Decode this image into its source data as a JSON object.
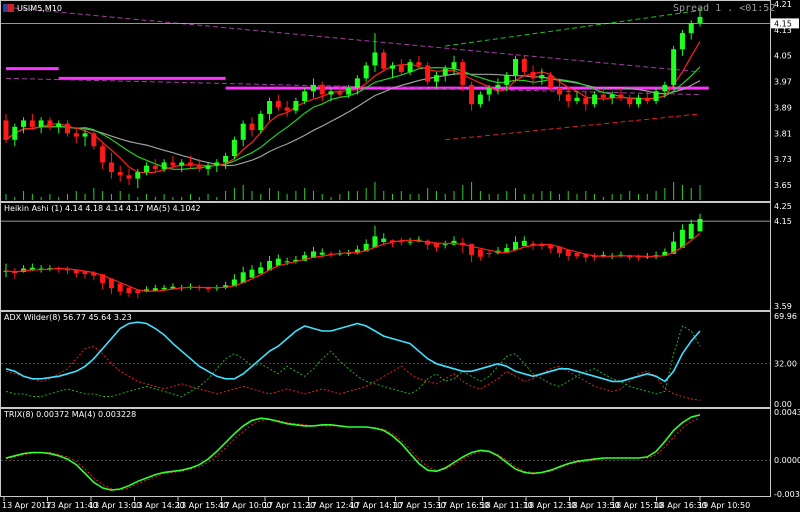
{
  "window": {
    "title": "USIM5,M10",
    "spread_text": "Spread 1 . <01:52"
  },
  "colors": {
    "background": "#000000",
    "bull": "#1fff1f",
    "bear": "#ff1a1a",
    "border": "#c8c8c8",
    "ma_fast": "#ff2020",
    "ma_mid": "#20d020",
    "ma_slow": "#a0a0a0",
    "magenta": "#ff33ff",
    "adx": "#40e0ff",
    "plus_di": "#20c020",
    "minus_di": "#ff2020",
    "trix": "#30ff30",
    "trix_signal": "#ff2020"
  },
  "chart_data": [
    {
      "type": "candlestick",
      "panel": "main",
      "title": "USIM5,M10",
      "ylim": [
        3.61,
        4.21
      ],
      "y_ticks": [
        "4.21",
        "4.13",
        "4.05",
        "3.97",
        "3.89",
        "3.81",
        "3.73",
        "3.65"
      ],
      "current_price": "4.15",
      "ohlc": [
        [
          3.85,
          3.87,
          3.78,
          3.79
        ],
        [
          3.79,
          3.84,
          3.77,
          3.83
        ],
        [
          3.83,
          3.86,
          3.81,
          3.85
        ],
        [
          3.85,
          3.87,
          3.82,
          3.83
        ],
        [
          3.83,
          3.86,
          3.81,
          3.85
        ],
        [
          3.85,
          3.86,
          3.82,
          3.83
        ],
        [
          3.83,
          3.85,
          3.81,
          3.84
        ],
        [
          3.84,
          3.85,
          3.8,
          3.81
        ],
        [
          3.81,
          3.83,
          3.78,
          3.8
        ],
        [
          3.8,
          3.82,
          3.77,
          3.81
        ],
        [
          3.81,
          3.82,
          3.76,
          3.77
        ],
        [
          3.77,
          3.78,
          3.7,
          3.72
        ],
        [
          3.72,
          3.75,
          3.67,
          3.69
        ],
        [
          3.69,
          3.71,
          3.66,
          3.68
        ],
        [
          3.68,
          3.7,
          3.65,
          3.67
        ],
        [
          3.67,
          3.7,
          3.64,
          3.69
        ],
        [
          3.69,
          3.72,
          3.68,
          3.71
        ],
        [
          3.71,
          3.73,
          3.69,
          3.7
        ],
        [
          3.7,
          3.73,
          3.69,
          3.72
        ],
        [
          3.72,
          3.74,
          3.7,
          3.71
        ],
        [
          3.71,
          3.73,
          3.69,
          3.72
        ],
        [
          3.72,
          3.74,
          3.7,
          3.71
        ],
        [
          3.71,
          3.73,
          3.69,
          3.7
        ],
        [
          3.7,
          3.72,
          3.68,
          3.71
        ],
        [
          3.71,
          3.73,
          3.69,
          3.72
        ],
        [
          3.72,
          3.75,
          3.7,
          3.74
        ],
        [
          3.74,
          3.8,
          3.73,
          3.79
        ],
        [
          3.79,
          3.85,
          3.77,
          3.84
        ],
        [
          3.84,
          3.86,
          3.8,
          3.82
        ],
        [
          3.82,
          3.88,
          3.81,
          3.87
        ],
        [
          3.87,
          3.92,
          3.85,
          3.91
        ],
        [
          3.91,
          3.93,
          3.88,
          3.89
        ],
        [
          3.89,
          3.91,
          3.86,
          3.88
        ],
        [
          3.88,
          3.92,
          3.87,
          3.91
        ],
        [
          3.91,
          3.95,
          3.9,
          3.94
        ],
        [
          3.94,
          3.98,
          3.92,
          3.96
        ],
        [
          3.96,
          3.97,
          3.91,
          3.93
        ],
        [
          3.93,
          3.95,
          3.91,
          3.94
        ],
        [
          3.94,
          3.96,
          3.92,
          3.93
        ],
        [
          3.93,
          3.96,
          3.92,
          3.95
        ],
        [
          3.95,
          3.99,
          3.93,
          3.98
        ],
        [
          3.98,
          4.03,
          3.97,
          4.02
        ],
        [
          4.02,
          4.12,
          4.0,
          4.06
        ],
        [
          4.06,
          4.07,
          4.0,
          4.01
        ],
        [
          4.01,
          4.03,
          3.98,
          4.02
        ],
        [
          4.02,
          4.04,
          3.99,
          4.0
        ],
        [
          4.0,
          4.04,
          3.99,
          4.03
        ],
        [
          4.03,
          4.05,
          4.01,
          4.02
        ],
        [
          4.02,
          4.03,
          3.96,
          3.97
        ],
        [
          3.97,
          4.0,
          3.95,
          3.99
        ],
        [
          3.99,
          4.02,
          3.97,
          4.01
        ],
        [
          4.01,
          4.05,
          3.99,
          4.03
        ],
        [
          4.03,
          4.04,
          3.94,
          3.96
        ],
        [
          3.96,
          3.97,
          3.88,
          3.9
        ],
        [
          3.9,
          3.94,
          3.89,
          3.93
        ],
        [
          3.93,
          3.96,
          3.91,
          3.95
        ],
        [
          3.95,
          3.98,
          3.93,
          3.96
        ],
        [
          3.96,
          4.0,
          3.94,
          3.99
        ],
        [
          3.99,
          4.05,
          3.97,
          4.04
        ],
        [
          4.04,
          4.05,
          3.99,
          4.0
        ],
        [
          4.0,
          4.02,
          3.96,
          3.98
        ],
        [
          3.98,
          4.01,
          3.96,
          3.99
        ],
        [
          3.99,
          4.0,
          3.94,
          3.95
        ],
        [
          3.95,
          3.97,
          3.91,
          3.93
        ],
        [
          3.93,
          3.95,
          3.89,
          3.91
        ],
        [
          3.91,
          3.94,
          3.9,
          3.92
        ],
        [
          3.92,
          3.94,
          3.88,
          3.9
        ],
        [
          3.9,
          3.94,
          3.89,
          3.93
        ],
        [
          3.93,
          3.95,
          3.91,
          3.92
        ],
        [
          3.92,
          3.94,
          3.9,
          3.93
        ],
        [
          3.93,
          3.95,
          3.91,
          3.92
        ],
        [
          3.92,
          3.93,
          3.89,
          3.9
        ],
        [
          3.9,
          3.93,
          3.89,
          3.92
        ],
        [
          3.92,
          3.94,
          3.9,
          3.91
        ],
        [
          3.91,
          3.95,
          3.9,
          3.94
        ],
        [
          3.94,
          3.97,
          3.92,
          3.96
        ],
        [
          3.96,
          4.08,
          3.95,
          4.07
        ],
        [
          4.07,
          4.13,
          4.05,
          4.12
        ],
        [
          4.12,
          4.16,
          4.1,
          4.15
        ],
        [
          4.15,
          4.2,
          4.14,
          4.17
        ]
      ],
      "magenta_steps": [
        {
          "from": 0,
          "to": 6,
          "value": 4.01
        },
        {
          "from": 6,
          "to": 25,
          "value": 3.98
        },
        {
          "from": 25,
          "to": 80,
          "value": 3.95
        }
      ],
      "trend_lines": [
        {
          "color": "green",
          "from": [
            50,
            4.08
          ],
          "to": [
            79,
            4.19
          ]
        },
        {
          "color": "red",
          "from": [
            50,
            3.79
          ],
          "to": [
            79,
            3.87
          ]
        },
        {
          "color": "purple",
          "from": [
            0,
            4.2
          ],
          "to": [
            79,
            4.0
          ]
        },
        {
          "color": "purple",
          "from": [
            0,
            3.98
          ],
          "to": [
            79,
            3.93
          ]
        }
      ],
      "volume": [
        2,
        1,
        3,
        2,
        1,
        2,
        1,
        2,
        3,
        2,
        4,
        3,
        2,
        3,
        2,
        1,
        2,
        1,
        2,
        1,
        1,
        2,
        1,
        2,
        1,
        3,
        4,
        5,
        3,
        2,
        4,
        3,
        2,
        3,
        4,
        3,
        2,
        1,
        2,
        3,
        3,
        4,
        6,
        3,
        2,
        3,
        2,
        2,
        4,
        3,
        2,
        3,
        5,
        6,
        3,
        2,
        2,
        3,
        4,
        2,
        2,
        3,
        3,
        2,
        3,
        2,
        3,
        2,
        1,
        2,
        2,
        3,
        2,
        2,
        3,
        4,
        6,
        5,
        4,
        5
      ]
    },
    {
      "type": "candlestick",
      "panel": "heikin_ashi",
      "title": "Heikin Ashi (1) 4.14 4.18 4.14 4.17 MA(5) 4.1042",
      "ylim": [
        3.59,
        4.25
      ],
      "y_ticks": [
        "4.25",
        "4.15",
        "3.59"
      ],
      "current_price": "4.15"
    },
    {
      "type": "line",
      "panel": "adx",
      "title": "ADX Wilder(8) 56.77 45.64 3.23",
      "ylim": [
        0,
        69.96
      ],
      "y_ticks": [
        "69.96",
        "32.00",
        "0.00"
      ],
      "reference_line": 32,
      "series": [
        {
          "name": "ADX",
          "values": [
            28,
            26,
            22,
            20,
            20,
            21,
            22,
            24,
            26,
            30,
            36,
            44,
            52,
            60,
            64,
            65,
            64,
            60,
            55,
            48,
            42,
            36,
            30,
            26,
            22,
            20,
            20,
            24,
            30,
            36,
            42,
            46,
            52,
            58,
            62,
            60,
            58,
            58,
            60,
            62,
            64,
            62,
            58,
            54,
            52,
            50,
            48,
            42,
            36,
            32,
            30,
            28,
            26,
            26,
            28,
            30,
            32,
            30,
            26,
            24,
            22,
            24,
            26,
            28,
            28,
            26,
            24,
            22,
            20,
            18,
            18,
            20,
            22,
            24,
            22,
            18,
            26,
            40,
            50,
            58
          ]
        },
        {
          "name": "+DI",
          "values": [
            10,
            8,
            8,
            6,
            6,
            8,
            10,
            12,
            10,
            8,
            8,
            6,
            6,
            8,
            10,
            12,
            14,
            12,
            10,
            8,
            6,
            10,
            14,
            20,
            28,
            36,
            40,
            36,
            30,
            32,
            28,
            24,
            30,
            26,
            22,
            28,
            36,
            42,
            34,
            28,
            22,
            18,
            16,
            14,
            12,
            10,
            8,
            12,
            20,
            24,
            18,
            20,
            26,
            22,
            18,
            22,
            30,
            38,
            40,
            32,
            24,
            20,
            16,
            14,
            18,
            22,
            26,
            28,
            24,
            20,
            18,
            14,
            12,
            10,
            8,
            10,
            40,
            62,
            58,
            46
          ]
        },
        {
          "name": "-DI",
          "values": [
            26,
            24,
            22,
            20,
            18,
            20,
            24,
            28,
            36,
            44,
            46,
            40,
            32,
            26,
            22,
            18,
            16,
            14,
            12,
            14,
            16,
            14,
            12,
            10,
            8,
            10,
            12,
            14,
            12,
            10,
            8,
            10,
            12,
            10,
            8,
            10,
            12,
            10,
            8,
            10,
            12,
            14,
            18,
            22,
            26,
            30,
            24,
            20,
            18,
            16,
            20,
            24,
            18,
            14,
            12,
            16,
            20,
            26,
            22,
            18,
            20,
            24,
            28,
            30,
            26,
            22,
            18,
            14,
            12,
            10,
            12,
            18,
            24,
            26,
            22,
            12,
            8,
            6,
            4,
            3
          ]
        }
      ]
    },
    {
      "type": "line",
      "panel": "trix",
      "title": "TRIX(8) 0.00372 MA(4) 0.003228",
      "ylim": [
        -0.00305,
        0.00436
      ],
      "y_ticks": [
        "0.00436",
        "0.0000",
        "-0.00305"
      ],
      "reference_line": 0,
      "series": [
        {
          "name": "TRIX(8)",
          "values": [
            0.0002,
            0.0004,
            0.0006,
            0.0007,
            0.0007,
            0.0006,
            0.0004,
            0.0001,
            -0.0004,
            -0.0012,
            -0.002,
            -0.0025,
            -0.0027,
            -0.0026,
            -0.0023,
            -0.0019,
            -0.0016,
            -0.0013,
            -0.0011,
            -0.001,
            -0.0009,
            -0.0007,
            -0.0004,
            0.0001,
            0.0008,
            0.0016,
            0.0024,
            0.0031,
            0.0036,
            0.0038,
            0.0037,
            0.0035,
            0.0033,
            0.0032,
            0.0031,
            0.0031,
            0.0032,
            0.0032,
            0.0031,
            0.003,
            0.003,
            0.003,
            0.0029,
            0.0027,
            0.0022,
            0.0015,
            0.0006,
            -0.0003,
            -0.0009,
            -0.001,
            -0.0007,
            -0.0002,
            0.0003,
            0.0007,
            0.0009,
            0.0008,
            0.0004,
            -0.0002,
            -0.0008,
            -0.0011,
            -0.0012,
            -0.0011,
            -0.0009,
            -0.0006,
            -0.0003,
            -0.0001,
            0.0,
            0.0001,
            0.0002,
            0.0002,
            0.0002,
            0.0002,
            0.0002,
            0.0003,
            0.0008,
            0.0017,
            0.0027,
            0.0034,
            0.0039,
            0.0041
          ]
        },
        {
          "name": "MA(4)",
          "values": [
            0.0001,
            0.0003,
            0.0005,
            0.0006,
            0.0007,
            0.0007,
            0.0005,
            0.0003,
            -0.0001,
            -0.0008,
            -0.0016,
            -0.0022,
            -0.0026,
            -0.0027,
            -0.0025,
            -0.0021,
            -0.0018,
            -0.0015,
            -0.0012,
            -0.0011,
            -0.001,
            -0.0008,
            -0.0006,
            -0.0002,
            0.0004,
            0.0011,
            0.0019,
            0.0026,
            0.0032,
            0.0036,
            0.0037,
            0.0036,
            0.0034,
            0.0033,
            0.0032,
            0.0031,
            0.0031,
            0.0031,
            0.0031,
            0.003,
            0.003,
            0.003,
            0.0029,
            0.0028,
            0.0024,
            0.0018,
            0.001,
            0.0001,
            -0.0006,
            -0.0009,
            -0.0008,
            -0.0004,
            0.0001,
            0.0005,
            0.0008,
            0.0008,
            0.0005,
            0.0,
            -0.0006,
            -0.001,
            -0.0011,
            -0.0011,
            -0.001,
            -0.0007,
            -0.0004,
            -0.0002,
            -0.0001,
            0.0,
            0.0001,
            0.0002,
            0.0002,
            0.0002,
            0.0002,
            0.0002,
            0.0005,
            0.0012,
            0.0021,
            0.0029,
            0.0035,
            0.0038
          ]
        }
      ]
    }
  ],
  "time_axis": {
    "labels": [
      "13 Apr 2017",
      "13 Apr 11:40",
      "13 Apr 13:00",
      "13 Apr 14:20",
      "13 Apr 15:40",
      "17 Apr 10:00",
      "17 Apr 11:20",
      "17 Apr 12:40",
      "17 Apr 14:10",
      "17 Apr 15:30",
      "17 Apr 16:50",
      "18 Apr 11:10",
      "18 Apr 12:30",
      "18 Apr 13:50",
      "18 Apr 15:10",
      "18 Apr 16:30",
      "19 Apr 10:50"
    ]
  }
}
